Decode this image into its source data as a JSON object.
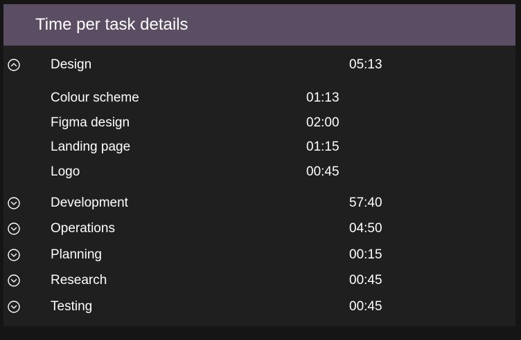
{
  "header": {
    "title": "Time per task details"
  },
  "tasks": [
    {
      "name": "Design",
      "time": "05:13",
      "expanded": true,
      "icon": "chevron-up-circle-icon",
      "subtasks": [
        {
          "name": "Colour scheme",
          "time": "01:13"
        },
        {
          "name": "Figma design",
          "time": "02:00"
        },
        {
          "name": "Landing page",
          "time": "01:15"
        },
        {
          "name": "Logo",
          "time": "00:45"
        }
      ]
    },
    {
      "name": "Development",
      "time": "57:40",
      "expanded": false,
      "icon": "chevron-down-circle-icon"
    },
    {
      "name": "Operations",
      "time": "04:50",
      "expanded": false,
      "icon": "chevron-down-circle-icon"
    },
    {
      "name": "Planning",
      "time": "00:15",
      "expanded": false,
      "icon": "chevron-down-circle-icon"
    },
    {
      "name": "Research",
      "time": "00:45",
      "expanded": false,
      "icon": "chevron-down-circle-icon"
    },
    {
      "name": "Testing",
      "time": "00:45",
      "expanded": false,
      "icon": "chevron-down-circle-icon"
    }
  ],
  "colors": {
    "header_bg": "#5b4d63",
    "panel_bg": "#1f1f1f",
    "page_bg": "#151515",
    "text": "#ffffff"
  }
}
